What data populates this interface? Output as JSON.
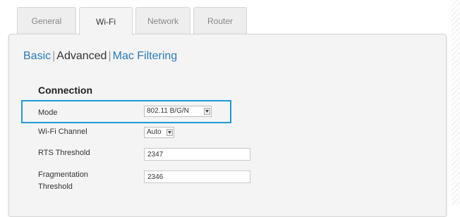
{
  "tabs": [
    {
      "label": "General",
      "active": false
    },
    {
      "label": "Wi-Fi",
      "active": true
    },
    {
      "label": "Network",
      "active": false
    },
    {
      "label": "Router",
      "active": false
    }
  ],
  "subnav": {
    "basic": "Basic",
    "separator": "|",
    "advanced": "Advanced",
    "mac_filtering": "Mac Filtering",
    "current": "Advanced"
  },
  "section": {
    "title": "Connection"
  },
  "fields": {
    "mode": {
      "label": "Mode",
      "value": "802.11 B/G/N",
      "highlighted": true
    },
    "wifi_channel": {
      "label": "Wi-Fi Channel",
      "value": "Auto"
    },
    "rts_threshold": {
      "label": "RTS Threshold",
      "value": "2347"
    },
    "fragmentation_threshold": {
      "label_line1": "Fragmentation",
      "label_line2": "Threshold",
      "value": "2346"
    }
  },
  "icons": {
    "dropdown": "chevron-down-icon"
  },
  "colors": {
    "link": "#2a7ab8",
    "highlight_box": "#1e9bd7",
    "panel_background": "#f4f4f4",
    "tab_inactive": "#eeeeee"
  }
}
